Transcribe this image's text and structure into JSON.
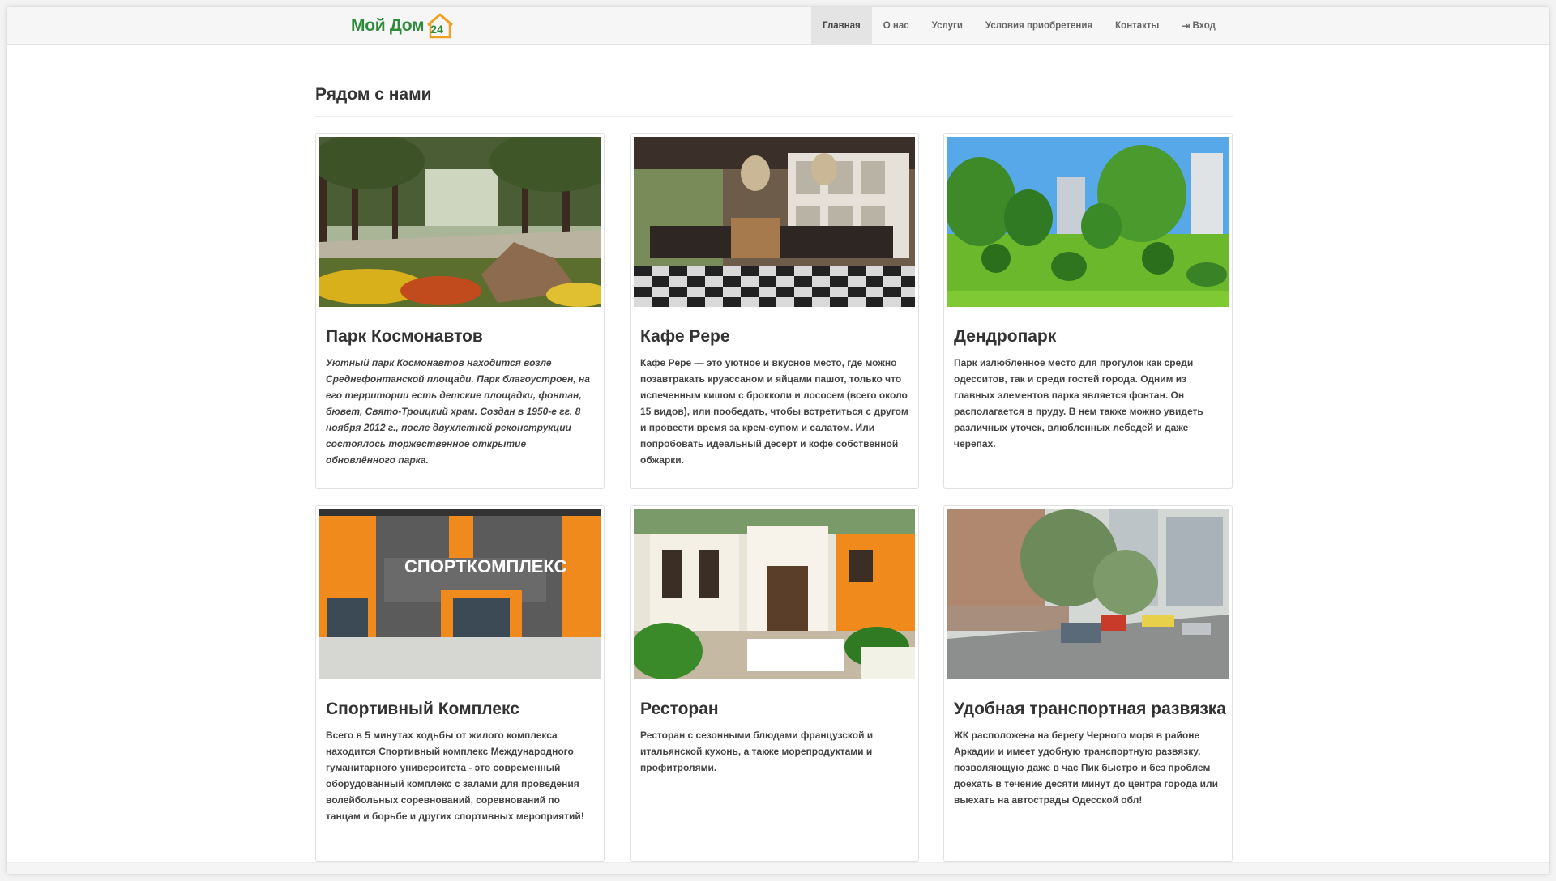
{
  "brand": {
    "logo_text": "Мой Дом",
    "logo_number": "24"
  },
  "nav": {
    "items": [
      {
        "label": "Главная",
        "active": true
      },
      {
        "label": "О нас"
      },
      {
        "label": "Услуги"
      },
      {
        "label": "Условия приобретения"
      },
      {
        "label": "Контакты"
      },
      {
        "label": "Вход",
        "icon": "login-icon"
      }
    ]
  },
  "page": {
    "title": "Рядом с нами"
  },
  "cards": [
    {
      "title": "Парк Космонавтов",
      "text": "Уютный парк Космонавтов находится возле Среднефонтанской площади. Парк благоустроен, на его территории есть детские площадки, фонтан, бювет, Свято-Троицкий храм. Создан в 1950-е гг. 8 ноября 2012 г., после двухлетней реконструкции состоялось торжественное открытие обновлённого парка."
    },
    {
      "title": "Кафе Pepe",
      "text": "Кафе Pepe — это уютное и вкусное место, где можно позавтракать круассаном и яйцами пашот, только что испеченным кишом с брокколи и лососем (всего около 15 видов), или пообедать, чтобы встретиться с другом и провести время за крем-супом и салатом. Или попробовать идеальный десерт и кофе собственной обжарки."
    },
    {
      "title": "Дендропарк",
      "text": "Парк излюбленное место для прогулок как среди одесситов, так и среди гостей города. Одним из главных элементов парка является фонтан. Он располагается в пруду. В нем также можно увидеть различных уточек, влюбленных лебедей и даже черепах."
    },
    {
      "title": "Спортивный Комплекс",
      "text": "Всего в 5 минутах ходьбы от жилого комплекса находится Спортивный комплекс Международного гуманитарного университета - это современный оборудованный комплекс с залами для проведения волейбольных соревнований, соревнований по танцам и борьбе и других спортивных мероприятий!",
      "sign": "СПОРТКОМПЛЕКС"
    },
    {
      "title": "Ресторан",
      "text": "Ресторан с сезонными блюдами французской и итальянской кухонь, а также морепродуктами и профитролями."
    },
    {
      "title": "Удобная транспортная развязка",
      "text": "ЖК  расположена на берегу Черного моря в районе Аркадии и имеет удобную транспортную развязку, позволяющую даже в час Пик быстро и без проблем доехать в течение десяти минут до центра города или выехать на автострады Одесской обл!"
    }
  ]
}
